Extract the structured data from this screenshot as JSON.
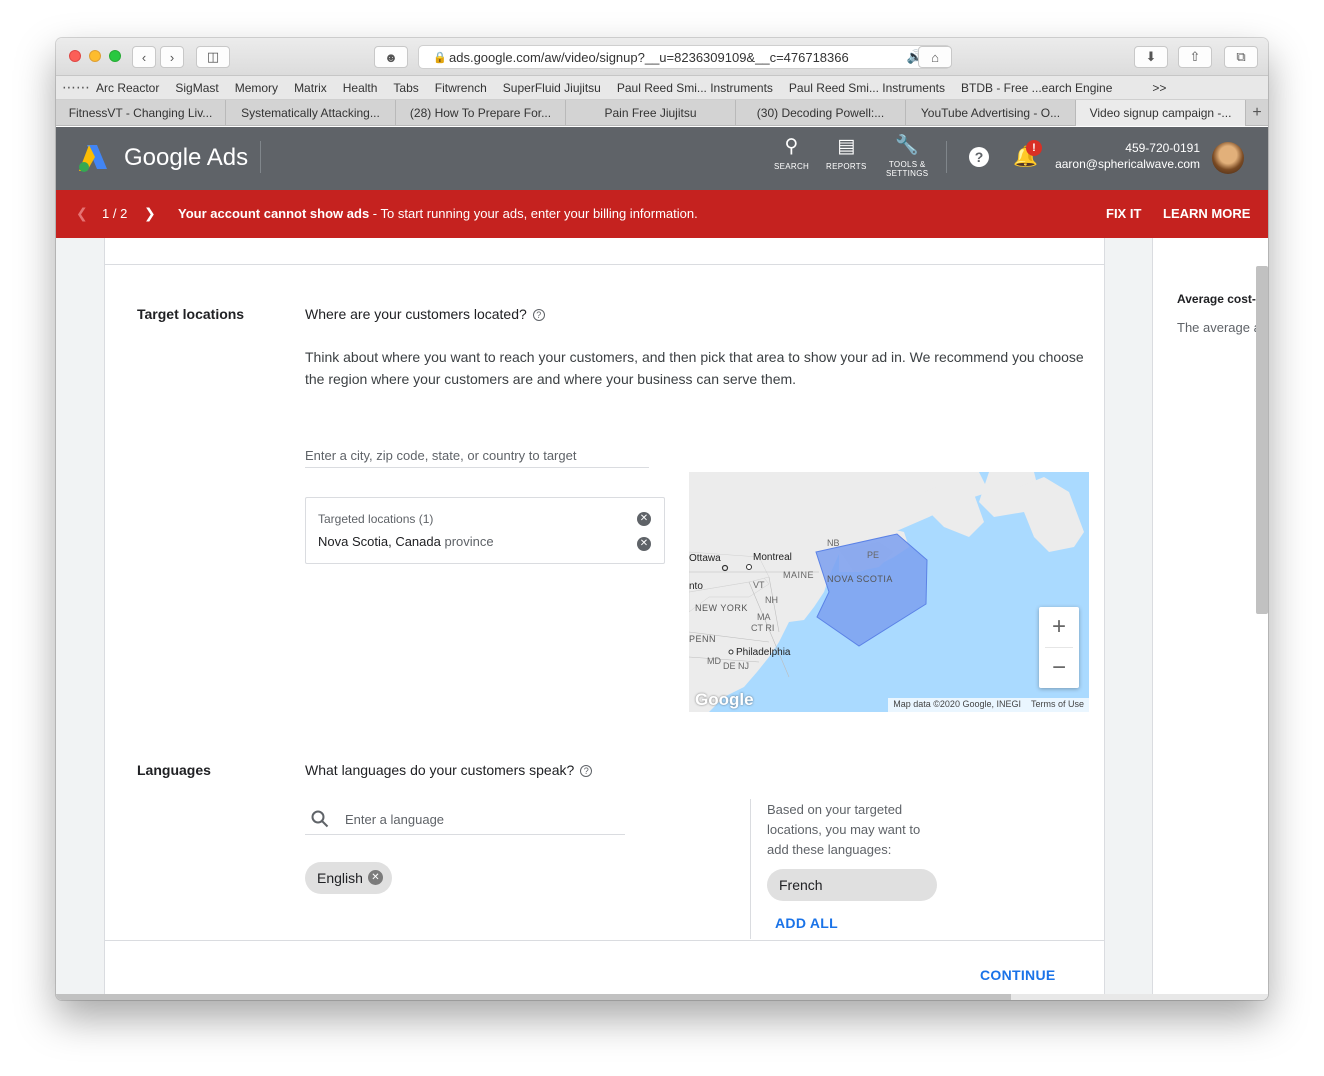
{
  "browser": {
    "url": "ads.google.com/aw/video/signup?__u=8236309109&__c=476718366",
    "bookmarks": [
      "Arc Reactor",
      "SigMast",
      "Memory",
      "Matrix",
      "Health",
      "Tabs",
      "Fitwrench",
      "SuperFluid Jiujitsu",
      "Paul Reed Smi... Instruments",
      "Paul Reed Smi... Instruments",
      "BTDB - Free ...earch Engine"
    ],
    "bookmarks_more": ">>",
    "tabs": [
      "FitnessVT - Changing Liv...",
      "Systematically Attacking...",
      "(28) How To Prepare For...",
      "Pain Free Jiujitsu",
      "(30) Decoding Powell:...",
      "YouTube Advertising - O...",
      "Video signup campaign -..."
    ],
    "active_tab_index": 6
  },
  "header": {
    "title": "Google Ads",
    "search_label": "SEARCH",
    "reports_label": "REPORTS",
    "tools_label_1": "TOOLS &",
    "tools_label_2": "SETTINGS",
    "notification_badge": "!",
    "phone": "459-720-0191",
    "email": "aaron@sphericalwave.com"
  },
  "banner": {
    "counter": "1 / 2",
    "message_bold": "Your account cannot show ads",
    "message_rest": " - To start running your ads, enter your billing information.",
    "fix_it": "FIX IT",
    "learn_more": "LEARN MORE",
    "color": "#c5221f"
  },
  "target_locations": {
    "label": "Target locations",
    "question": "Where are your customers located?",
    "description": "Think about where you want to reach your customers, and then pick that area to show your ad in. We recommend you choose the region where your customers are and where your business can serve them.",
    "input_placeholder": "Enter a city, zip code, state, or country to target",
    "targeted_label": "Targeted locations (1)",
    "targeted_place": "Nova Scotia, Canada",
    "targeted_type": "province"
  },
  "map": {
    "labels": [
      "Ottawa",
      "Montreal",
      "NB",
      "PE",
      "NOVA SCOTIA",
      "VT",
      "MAINE",
      "NEW YORK",
      "NH",
      "MA",
      "CT RI",
      "PENN",
      "Philadelphia",
      "MD",
      "DE NJ",
      "nto"
    ],
    "attribution": "Map data ©2020 Google, INEGI",
    "terms": "Terms of Use",
    "brand": "Google"
  },
  "languages": {
    "label": "Languages",
    "question": "What languages do your customers speak?",
    "input_placeholder": "Enter a language",
    "selected": "English",
    "suggestion_text": "Based on your targeted locations, you may want to add these languages:",
    "suggested": "French",
    "add_all": "ADD ALL"
  },
  "footer": {
    "continue": "CONTINUE"
  },
  "side_panel": {
    "title": "Average cost-pe",
    "text": "The average ar"
  }
}
